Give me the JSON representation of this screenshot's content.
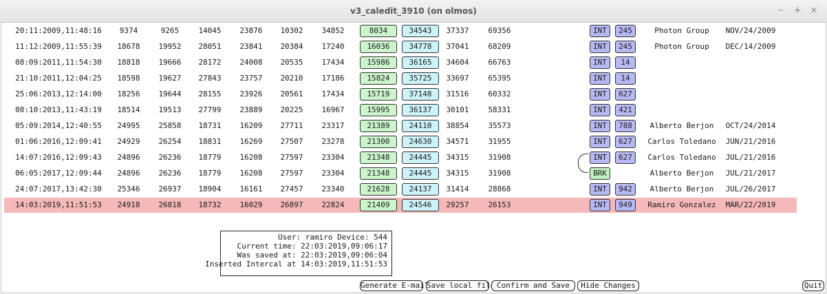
{
  "window": {
    "title": "v3_caledit_3910 (on olmos)",
    "minimize": "–",
    "maximize": "+",
    "close": "×"
  },
  "rows": [
    {
      "date": "20:11:2009,11:48:16",
      "v1": "9374",
      "v2": "9265",
      "v3": "14045",
      "v4": "23876",
      "v5": "10302",
      "v6": "34852",
      "g": "8034",
      "c": "34543",
      "v7": "37337",
      "v8": "69356",
      "type": "INT",
      "num": "245",
      "who": "Photon Group",
      "when": "NOV/24/2009"
    },
    {
      "date": "11:12:2009,11:55:39",
      "v1": "18678",
      "v2": "19952",
      "v3": "28051",
      "v4": "23841",
      "v5": "20384",
      "v6": "17240",
      "g": "16036",
      "c": "34778",
      "v7": "37041",
      "v8": "68209",
      "type": "INT",
      "num": "245",
      "who": "Photon Group",
      "when": "DEC/14/2009"
    },
    {
      "date": "08:09:2011,11:54:30",
      "v1": "18818",
      "v2": "19666",
      "v3": "28172",
      "v4": "24008",
      "v5": "20535",
      "v6": "17434",
      "g": "15986",
      "c": "36165",
      "v7": "34604",
      "v8": "66763",
      "type": "INT",
      "num": "14",
      "who": "",
      "when": ""
    },
    {
      "date": "21:10:2011,12:04:25",
      "v1": "18598",
      "v2": "19627",
      "v3": "27843",
      "v4": "23757",
      "v5": "20210",
      "v6": "17186",
      "g": "15824",
      "c": "35725",
      "v7": "33697",
      "v8": "65395",
      "type": "INT",
      "num": "14",
      "who": "",
      "when": ""
    },
    {
      "date": "25:06:2013,12:14:00",
      "v1": "18256",
      "v2": "19644",
      "v3": "28155",
      "v4": "23926",
      "v5": "20561",
      "v6": "17434",
      "g": "15719",
      "c": "37148",
      "v7": "31516",
      "v8": "60332",
      "type": "INT",
      "num": "627",
      "who": "",
      "when": ""
    },
    {
      "date": "08:10:2013,11:43:19",
      "v1": "18514",
      "v2": "19513",
      "v3": "27799",
      "v4": "23889",
      "v5": "20225",
      "v6": "16967",
      "g": "15995",
      "c": "36137",
      "v7": "30101",
      "v8": "58331",
      "type": "INT",
      "num": "421",
      "who": "",
      "when": ""
    },
    {
      "date": "05:09:2014,12:40:55",
      "v1": "24995",
      "v2": "25858",
      "v3": "18731",
      "v4": "16209",
      "v5": "27711",
      "v6": "23317",
      "g": "21389",
      "c": "24110",
      "v7": "38854",
      "v8": "35573",
      "type": "INT",
      "num": "788",
      "who": "Alberto Berjon",
      "when": "OCT/24/2014"
    },
    {
      "date": "01:06:2016,12:09:41",
      "v1": "24929",
      "v2": "26254",
      "v3": "18831",
      "v4": "16269",
      "v5": "27507",
      "v6": "23278",
      "g": "21300",
      "c": "24630",
      "v7": "34571",
      "v8": "31955",
      "type": "INT",
      "num": "627",
      "who": "Carlos Toledano",
      "when": "JUN/21/2016"
    },
    {
      "date": "14:07:2016,12:09:43",
      "v1": "24896",
      "v2": "26236",
      "v3": "18779",
      "v4": "16208",
      "v5": "27597",
      "v6": "23304",
      "g": "21348",
      "c": "24445",
      "v7": "34315",
      "v8": "31908",
      "type": "INT",
      "num": "627",
      "who": "Carlos Toledano",
      "when": "JUL/21/2016"
    },
    {
      "date": "06:05:2017,12:09:44",
      "v1": "24896",
      "v2": "26236",
      "v3": "18779",
      "v4": "16208",
      "v5": "27597",
      "v6": "23304",
      "g": "21348",
      "c": "24445",
      "v7": "34315",
      "v8": "31908",
      "type": "BRK",
      "num": "",
      "who": "Alberto Berjon",
      "when": "JUL/21/2017"
    },
    {
      "date": "24:07:2017,13:42:30",
      "v1": "25346",
      "v2": "26937",
      "v3": "18904",
      "v4": "16161",
      "v5": "27457",
      "v6": "23340",
      "g": "21628",
      "c": "24137",
      "v7": "31414",
      "v8": "28868",
      "type": "INT",
      "num": "942",
      "who": "Alberto Berjon",
      "when": "JUL/26/2017"
    },
    {
      "date": "14:03:2019,11:51:53",
      "v1": "24918",
      "v2": "26818",
      "v3": "18732",
      "v4": "16029",
      "v5": "26897",
      "v6": "22824",
      "g": "21409",
      "c": "24546",
      "v7": "29257",
      "v8": "26153",
      "type": "INT",
      "num": "949",
      "who": "Ramiro Gonzalez",
      "when": "MAR/22/2019",
      "highlight": true
    }
  ],
  "info": {
    "line1": "User: ramiro Device: 544",
    "line2": "Current time: 22:03:2019,09:06:17",
    "line3": "Was saved at: 22:03:2019,09:06:04",
    "line4": "Inserted Intercal at 14:03:2019,11:51:53"
  },
  "buttons": {
    "generate_email": "Generate E-mail",
    "save_local": "Save local file",
    "confirm_save": "Confirm and Save",
    "hide_changes": "Hide Changes",
    "quit": "Quit"
  },
  "colors": {
    "highlight_row": "#f5b9b9",
    "green_box": "#ccf5cc",
    "cyan_box": "#cdf3f8",
    "blue_box": "#b7b9f2"
  }
}
